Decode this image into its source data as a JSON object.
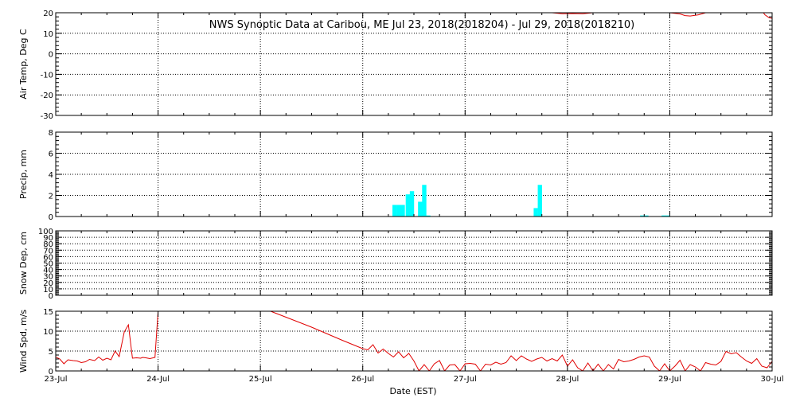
{
  "title": "NWS Synoptic Data at Caribou, ME   Jul 23, 2018(2018204) - Jul 29, 2018(2018210)",
  "xlabel": "Date (EST)",
  "x_tick_labels": [
    "23-Jul",
    "24-Jul",
    "25-Jul",
    "26-Jul",
    "27-Jul",
    "28-Jul",
    "29-Jul",
    "30-Jul"
  ],
  "colors": {
    "line": "#e00000",
    "precip": "#00ffff",
    "axes": "#000000",
    "background": "#ffffff"
  },
  "chart_data": [
    {
      "type": "line",
      "ylabel": "Air Temp, Deg C",
      "ylim": [
        -30,
        20
      ],
      "yticks": [
        -30,
        -20,
        -10,
        0,
        10,
        20
      ],
      "xlim": [
        0,
        7
      ],
      "grid": true,
      "series": [
        {
          "x": [
            4.78,
            4.85,
            4.95,
            5.05,
            5.15,
            5.25,
            5.33,
            5.4
          ],
          "y": [
            21,
            20,
            19.5,
            19.6,
            19.5,
            20,
            20.5,
            21
          ]
        },
        {
          "x": [
            5.95,
            6.0,
            6.1,
            6.15,
            6.2,
            6.28,
            6.35,
            6.4
          ],
          "y": [
            21,
            20,
            19.4,
            18.6,
            18.4,
            19,
            20,
            21
          ]
        },
        {
          "x": [
            6.9,
            6.93,
            6.97,
            7.0
          ],
          "y": [
            21,
            19,
            17.6,
            17.2
          ]
        }
      ]
    },
    {
      "type": "bar",
      "ylabel": "Precip, mm",
      "ylim": [
        0,
        8
      ],
      "yticks": [
        0,
        2,
        4,
        6,
        8
      ],
      "xlim": [
        0,
        7
      ],
      "grid": true,
      "bar_width_days": 0.0417,
      "x": [
        3.29,
        3.33,
        3.37,
        3.42,
        3.46,
        3.54,
        3.58,
        3.62,
        4.67,
        4.71,
        5.71,
        5.75,
        5.92,
        5.96
      ],
      "values": [
        1.1,
        1.1,
        1.1,
        2.1,
        2.4,
        1.4,
        3.0,
        0.1,
        0.8,
        3.0,
        0.1,
        0.1,
        0.1,
        0.1
      ]
    },
    {
      "type": "line",
      "ylabel": "Snow Dep, cm",
      "ylim": [
        0,
        100
      ],
      "yticks": [
        0,
        10,
        20,
        30,
        40,
        50,
        60,
        70,
        80,
        90,
        100
      ],
      "xlim": [
        0,
        7
      ],
      "grid": true,
      "series": []
    },
    {
      "type": "line",
      "ylabel": "Wind Spd, m/s",
      "ylim": [
        0,
        15
      ],
      "yticks": [
        0,
        5,
        10,
        15
      ],
      "xlim": [
        0,
        7
      ],
      "grid": true,
      "series": [
        {
          "x": [
            0.0,
            0.04,
            0.08,
            0.12,
            0.17,
            0.21,
            0.25,
            0.29,
            0.33,
            0.38,
            0.42,
            0.46,
            0.5,
            0.54,
            0.58,
            0.62,
            0.67,
            0.71,
            0.75,
            0.79,
            0.83,
            0.85,
            0.88,
            0.92,
            0.97,
            1.0,
            1.01,
            1.02
          ],
          "y": [
            3.5,
            3.0,
            1.8,
            2.8,
            2.6,
            2.5,
            2.1,
            2.3,
            2.9,
            2.6,
            3.5,
            2.7,
            3.2,
            2.8,
            5.0,
            3.6,
            9.8,
            11.6,
            3.2,
            3.3,
            3.2,
            3.4,
            3.3,
            3.1,
            3.4,
            15.0,
            15.0,
            15.0
          ]
        },
        {
          "x": [
            1.1,
            1.15
          ],
          "y": [
            15.0,
            15.0
          ]
        },
        {
          "x": [
            2.1,
            2.2,
            2.5,
            2.8,
            3.0,
            3.05,
            3.1,
            3.15,
            3.2,
            3.25,
            3.3,
            3.35,
            3.4,
            3.45,
            3.5,
            3.55,
            3.6,
            3.65,
            3.7,
            3.75,
            3.8,
            3.85,
            3.9,
            3.95,
            4.0,
            4.05,
            4.1,
            4.15,
            4.2,
            4.25,
            4.3,
            4.35,
            4.4,
            4.45,
            4.5,
            4.55,
            4.6,
            4.65,
            4.7,
            4.75,
            4.8,
            4.85,
            4.9,
            4.95,
            5.0,
            5.05,
            5.1,
            5.15,
            5.2,
            5.25,
            5.3,
            5.35,
            5.4,
            5.45,
            5.5,
            5.55,
            5.6,
            5.65,
            5.7,
            5.75,
            5.8,
            5.85,
            5.9,
            5.95,
            6.0,
            6.05,
            6.1,
            6.15,
            6.2,
            6.25,
            6.3,
            6.35,
            6.4,
            6.45,
            6.5,
            6.55,
            6.6,
            6.65,
            6.7,
            6.75,
            6.8,
            6.85,
            6.9,
            6.95,
            7.0
          ],
          "y": [
            15.0,
            14.0,
            11.0,
            7.7,
            5.6,
            5.3,
            6.6,
            4.5,
            5.5,
            4.4,
            3.5,
            4.8,
            3.3,
            4.4,
            2.5,
            0.0,
            1.6,
            0.0,
            1.8,
            2.6,
            0.0,
            1.5,
            1.6,
            0.0,
            1.8,
            1.9,
            1.7,
            0.0,
            1.7,
            1.5,
            2.2,
            1.7,
            2.1,
            3.8,
            2.6,
            3.8,
            3.0,
            2.4,
            3.0,
            3.4,
            2.5,
            3.1,
            2.5,
            4.0,
            1.2,
            2.8,
            0.8,
            0.0,
            2.0,
            0.0,
            1.7,
            0.0,
            1.6,
            0.5,
            2.9,
            2.3,
            2.5,
            2.9,
            3.5,
            3.8,
            3.5,
            1.2,
            0.0,
            1.8,
            0.0,
            1.2,
            2.7,
            0.0,
            1.6,
            1.0,
            0.0,
            2.1,
            1.7,
            1.5,
            2.4,
            4.9,
            4.3,
            4.6,
            3.5,
            2.5,
            1.9,
            3.1,
            1.2,
            0.8,
            2.4
          ]
        }
      ]
    }
  ]
}
